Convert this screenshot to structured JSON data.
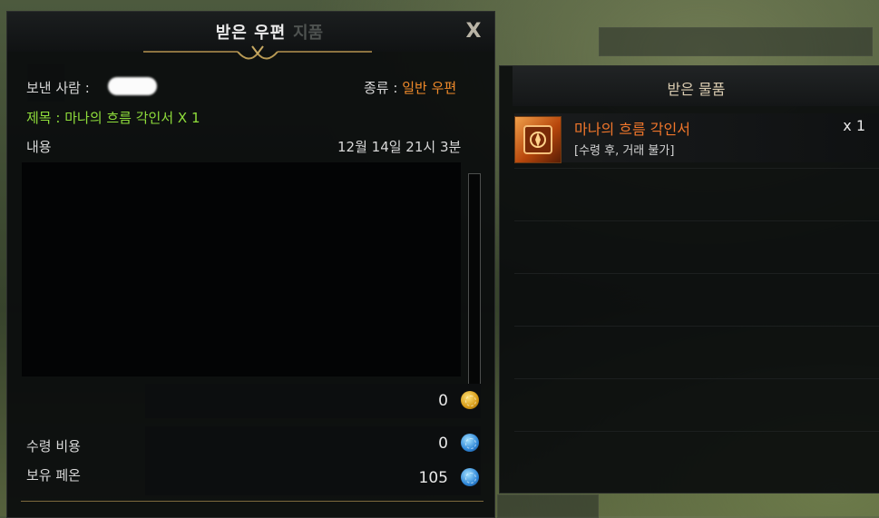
{
  "mail": {
    "title": "받은 우편",
    "ghost_tab": "지품",
    "close_label": "X",
    "sender_label": "보낸 사람 :",
    "type_label": "종류 :",
    "type_value": "일반 우편",
    "subject_label": "제목 :",
    "subject_value": "마나의 흐름 각인서 X 1",
    "content_label": "내용",
    "date": "12월 14일 21시 3분",
    "attached_gold": "0",
    "fee_label": "수령 비용",
    "fee_value": "0",
    "owned_label": "보유 페온",
    "owned_value": "105"
  },
  "items": {
    "title": "받은 물품",
    "list": [
      {
        "name": "마나의 흐름 각인서",
        "note": "[수령 후, 거래 불가]",
        "qty": "x 1",
        "icon": "engraving-book-icon"
      }
    ]
  },
  "colors": {
    "accent_orange": "#f08a2a",
    "subject_green": "#8fdd3b",
    "item_name": "#f0762b"
  }
}
